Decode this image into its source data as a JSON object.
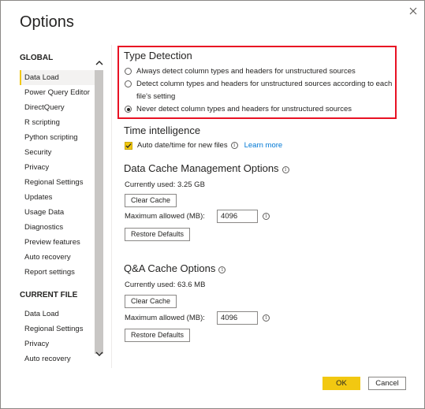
{
  "dialog": {
    "title": "Options",
    "ok_label": "OK",
    "cancel_label": "Cancel"
  },
  "sidebar": {
    "global_header": "GLOBAL",
    "global_items": [
      {
        "label": "Data Load",
        "active": true
      },
      {
        "label": "Power Query Editor"
      },
      {
        "label": "DirectQuery"
      },
      {
        "label": "R scripting"
      },
      {
        "label": "Python scripting"
      },
      {
        "label": "Security"
      },
      {
        "label": "Privacy"
      },
      {
        "label": "Regional Settings"
      },
      {
        "label": "Updates"
      },
      {
        "label": "Usage Data"
      },
      {
        "label": "Diagnostics"
      },
      {
        "label": "Preview features"
      },
      {
        "label": "Auto recovery"
      },
      {
        "label": "Report settings"
      }
    ],
    "current_file_header": "CURRENT FILE",
    "current_file_items": [
      {
        "label": "Data Load"
      },
      {
        "label": "Regional Settings"
      },
      {
        "label": "Privacy"
      },
      {
        "label": "Auto recovery"
      }
    ]
  },
  "type_detection": {
    "title": "Type Detection",
    "options": [
      {
        "label": "Always detect column types and headers for unstructured sources",
        "checked": false
      },
      {
        "label": "Detect column types and headers for unstructured sources according to each file's setting",
        "checked": false
      },
      {
        "label": "Never detect column types and headers for unstructured sources",
        "checked": true
      }
    ]
  },
  "time_intelligence": {
    "title": "Time intelligence",
    "checkbox_label": "Auto date/time for new files",
    "checked": true,
    "learn_more": "Learn more"
  },
  "data_cache": {
    "title": "Data Cache Management Options",
    "currently_used": "Currently used: 3.25 GB",
    "clear_label": "Clear Cache",
    "max_label": "Maximum allowed (MB):",
    "max_value": "4096",
    "restore_label": "Restore Defaults"
  },
  "qa_cache": {
    "title": "Q&A Cache Options",
    "currently_used": "Currently used: 63.6 MB",
    "clear_label": "Clear Cache",
    "max_label": "Maximum allowed (MB):",
    "max_value": "4096",
    "restore_label": "Restore Defaults"
  },
  "colors": {
    "accent": "#f2c811",
    "highlight_border": "#e81123",
    "link": "#0078d4"
  }
}
